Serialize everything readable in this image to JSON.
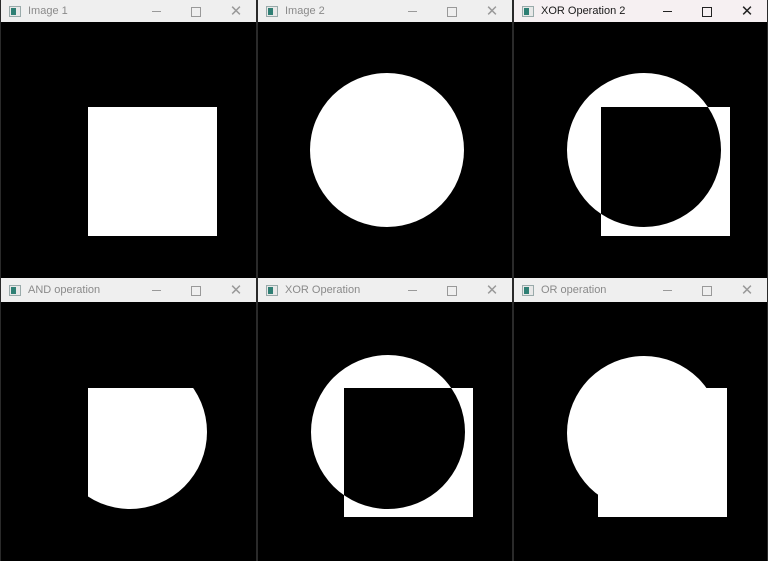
{
  "windows": [
    {
      "id": "image1",
      "title": "Image 1",
      "state": "inactive",
      "operation": "square"
    },
    {
      "id": "image2",
      "title": "Image 2",
      "state": "inactive",
      "operation": "circle"
    },
    {
      "id": "xor2",
      "title": "XOR Operation 2",
      "state": "active",
      "operation": "xor"
    },
    {
      "id": "and",
      "title": "AND operation",
      "state": "inactive",
      "operation": "and"
    },
    {
      "id": "xor",
      "title": "XOR Operation",
      "state": "inactive",
      "operation": "xor"
    },
    {
      "id": "or",
      "title": "OR operation",
      "state": "inactive",
      "operation": "or"
    }
  ],
  "controls": {
    "minimize": "minimize",
    "maximize": "maximize",
    "close": "✕"
  },
  "colors": {
    "foreground": "#ffffff",
    "background": "#000000"
  }
}
